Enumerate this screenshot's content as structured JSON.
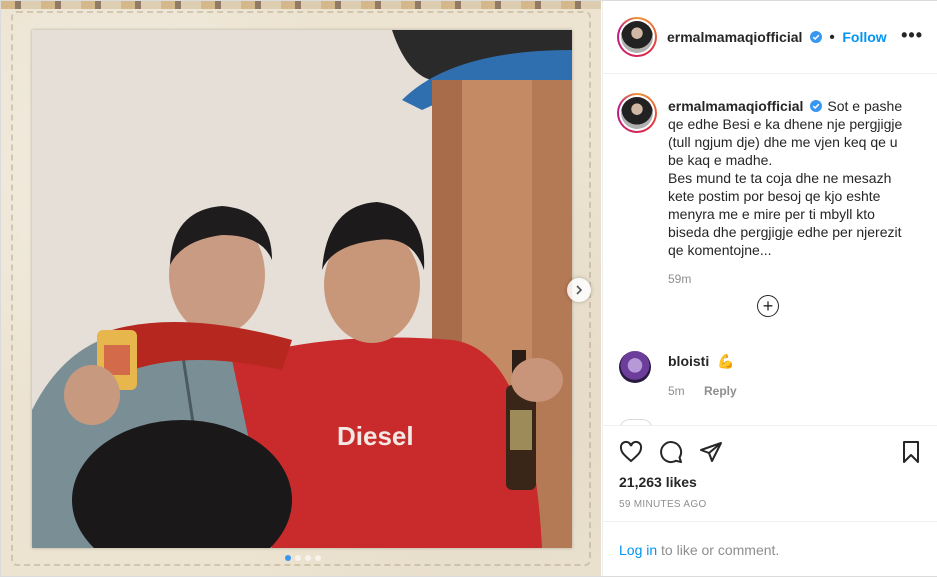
{
  "post": {
    "username": "ermalmamaqiofficial",
    "follow_separator": "•",
    "follow_label": "Follow",
    "more_label": "•••",
    "caption_p1": "Sot e pashe qe edhe Besi e ka dhene nje pergjigje (tull ngjum dje) dhe me vjen keq qe u be kaq e madhe.",
    "caption_p2": "Bes mund te ta coja dhe ne mesazh kete postim por besoj qe kjo eshte menyra me e mire per ti mbyll kto biseda dhe pergjigje edhe per njerezit qe komentojne...",
    "caption_age": "59m",
    "load_more_label": "+",
    "shirt_text": "Diesel"
  },
  "comments": [
    {
      "username": "bloisti",
      "text": "💪",
      "age": "5m",
      "reply_label": "Reply"
    }
  ],
  "stats": {
    "likes": "21,263 likes",
    "posted": "59 MINUTES AGO"
  },
  "login": {
    "link_label": "Log in",
    "rest_label": " to like or comment."
  },
  "icons": {
    "verified": "verified-badge-icon",
    "like": "heart-icon",
    "comment": "comment-bubble-icon",
    "share": "paper-plane-icon",
    "save": "bookmark-icon",
    "next": "chevron-right-icon"
  },
  "colors": {
    "accent": "#0095f6",
    "verified": "#3897f0",
    "muted": "#8e8e8e",
    "text": "#262626"
  },
  "carousel": {
    "count": 4,
    "active": 1
  }
}
